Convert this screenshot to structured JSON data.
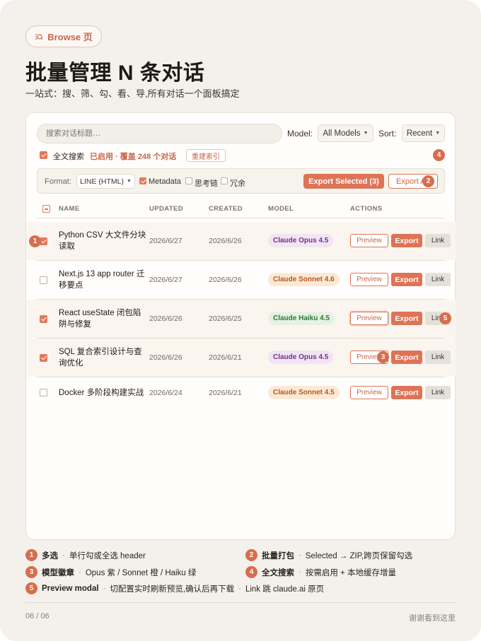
{
  "header": {
    "pill_label": "Browse 页",
    "title": "批量管理 N 条对话",
    "subtitle": "一站式：搜、筛、勾、看、导,所有对话一个面板搞定"
  },
  "toolbar": {
    "search_placeholder": "搜索对话标题…",
    "model_label": "Model:",
    "model_value": "All Models",
    "sort_label": "Sort:",
    "sort_value": "Recent",
    "fulltext_label": "全文搜索",
    "fulltext_status": "已启用 · 覆盖 248 个对话",
    "reindex_label": "重建索引",
    "format_label": "Format:",
    "format_value": "LINE (HTML)",
    "opt_metadata": "Metadata",
    "opt_thinking": "思考链",
    "opt_redundant": "冗余",
    "export_selected": "Export Selected (3)",
    "export_all": "Export All"
  },
  "columns": [
    "NAME",
    "UPDATED",
    "CREATED",
    "MODEL",
    "ACTIONS"
  ],
  "rows": [
    {
      "name": "Python CSV 大文件分块读取",
      "updated": "2026/6/27",
      "created": "2026/6/26",
      "model": "Claude Opus 4.5",
      "checked": true
    },
    {
      "name": "Next.js 13 app router 迁移要点",
      "updated": "2026/6/27",
      "created": "2026/6/26",
      "model": "Claude Sonnet 4.6",
      "checked": false
    },
    {
      "name": "React useState 闭包陷阱与修复",
      "updated": "2026/6/26",
      "created": "2026/6/25",
      "model": "Claude Haiku 4.5",
      "checked": true
    },
    {
      "name": "SQL 复合索引设计与查询优化",
      "updated": "2026/6/26",
      "created": "2026/6/21",
      "model": "Claude Opus 4.5",
      "checked": true
    },
    {
      "name": "Docker 多阶段构建实战",
      "updated": "2026/6/24",
      "created": "2026/6/21",
      "model": "Claude Sonnet 4.5",
      "checked": false
    }
  ],
  "actions": {
    "preview": "Preview",
    "export": "Export",
    "link": "Link"
  },
  "markers": [
    "1",
    "2",
    "3",
    "4",
    "5"
  ],
  "legend": {
    "m1_title": "多选",
    "m1_text": "单行勾或全选 header",
    "m2_title": "批量打包",
    "m2_text": "Selected → ZIP,跨页保留勾选",
    "m3_title": "模型徽章",
    "m3_text": "Opus 紫 / Sonnet 橙 / Haiku 绿",
    "m4_title": "全文搜索",
    "m4_text": "按需启用 + 本地缓存增量",
    "m5_title": "Preview modal",
    "m5_text": "切配置实时刷新预览,确认后再下载",
    "m5_extra": "Link 跳 claude.ai 原页",
    "sep": "·"
  },
  "footer": {
    "page": "06 / 06",
    "thanks": "谢谢看到这里"
  },
  "colors": {
    "accent": "#dd7456",
    "opus": "#7a2e8a",
    "sonnet": "#b8591b",
    "haiku": "#2f7a34"
  }
}
